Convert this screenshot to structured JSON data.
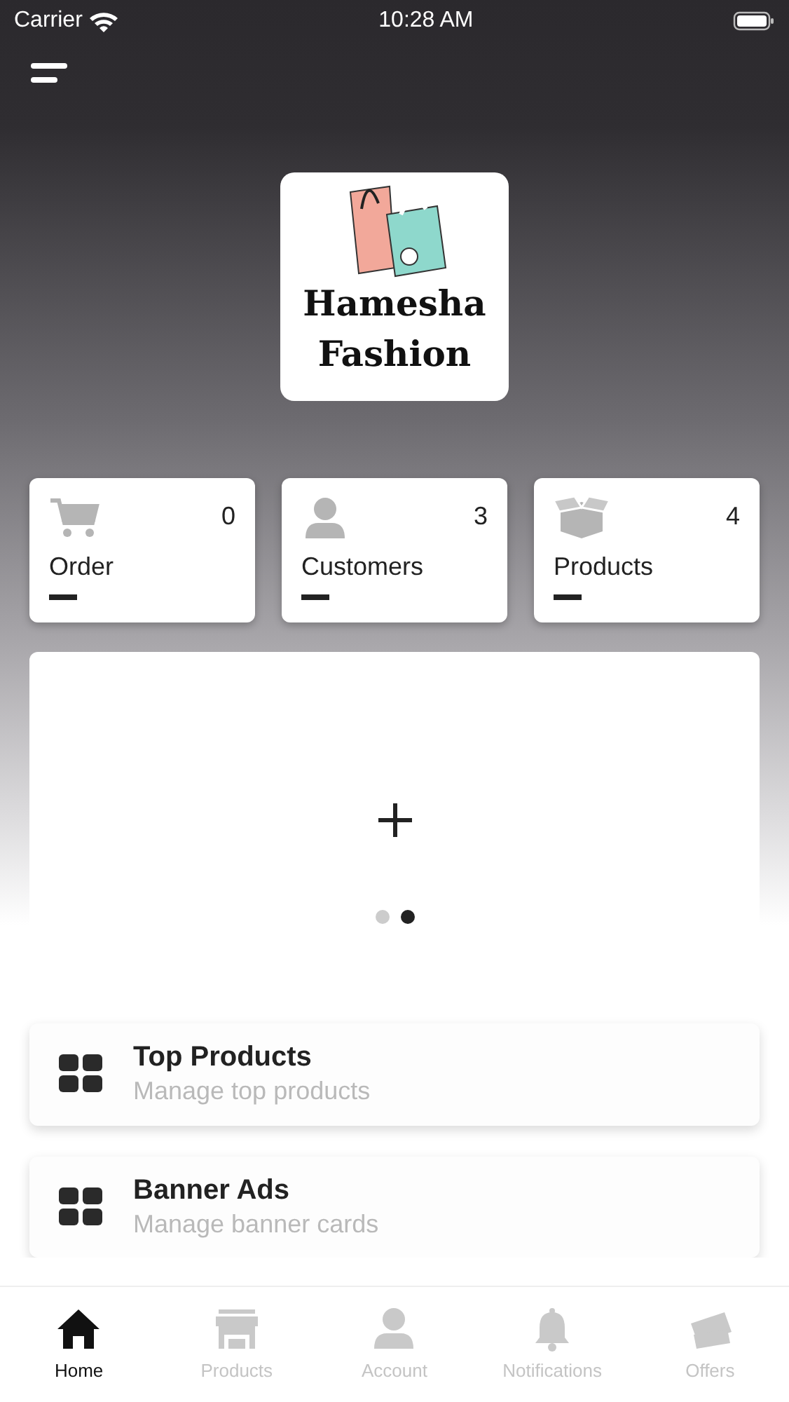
{
  "status_bar": {
    "carrier": "Carrier",
    "time": "10:28 AM"
  },
  "logo": {
    "lines": [
      "Hamesha",
      "Fashion"
    ]
  },
  "stats": [
    {
      "kind": "cart",
      "count": "0",
      "label": "Order"
    },
    {
      "kind": "person",
      "count": "3",
      "label": "Customers"
    },
    {
      "kind": "box",
      "count": "4",
      "label": "Products"
    }
  ],
  "carousel": {
    "dots": [
      {
        "selected": false
      },
      {
        "selected": true
      }
    ]
  },
  "menu_items": [
    {
      "title": "Top Products",
      "subtitle": "Manage top products"
    },
    {
      "title": "Banner Ads",
      "subtitle": "Manage banner cards"
    }
  ],
  "tabs": [
    {
      "kind": "home",
      "label": "Home",
      "selected": true
    },
    {
      "kind": "store",
      "label": "Products",
      "selected": false
    },
    {
      "kind": "person",
      "label": "Account",
      "selected": false
    },
    {
      "kind": "bell",
      "label": "Notifications",
      "selected": false
    },
    {
      "kind": "offer",
      "label": "Offers",
      "selected": false
    }
  ]
}
